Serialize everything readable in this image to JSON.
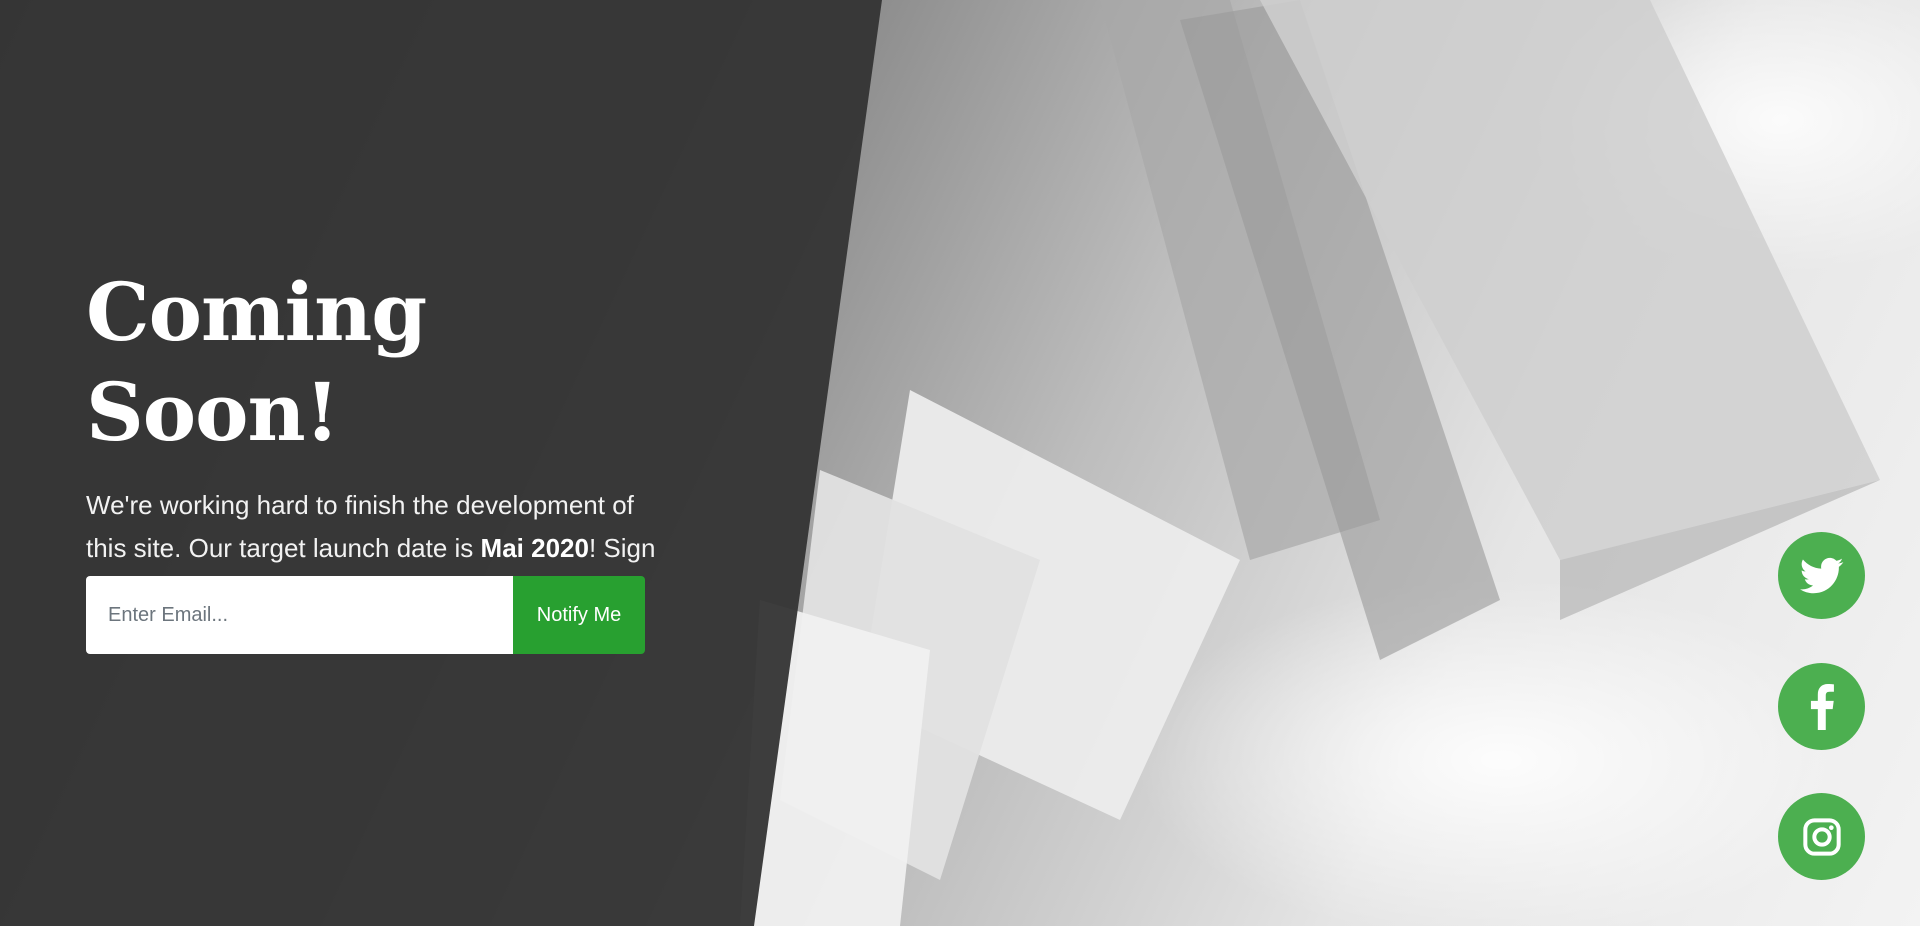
{
  "hero": {
    "title": "Coming Soon!",
    "description_part1": "We're working hard to finish the development of this site. Our target launch date is ",
    "launch_date": "Mai 2020",
    "description_part2": "! Sign up for updates using the form below!"
  },
  "form": {
    "email_placeholder": "Enter Email...",
    "email_value": "",
    "submit_label": "Notify Me"
  },
  "social": [
    {
      "icon": "twitter-icon"
    },
    {
      "icon": "facebook-icon"
    },
    {
      "icon": "instagram-icon"
    }
  ],
  "colors": {
    "accent_green": "#28a030",
    "social_green": "#4caf50",
    "overlay_dark": "#343434"
  }
}
